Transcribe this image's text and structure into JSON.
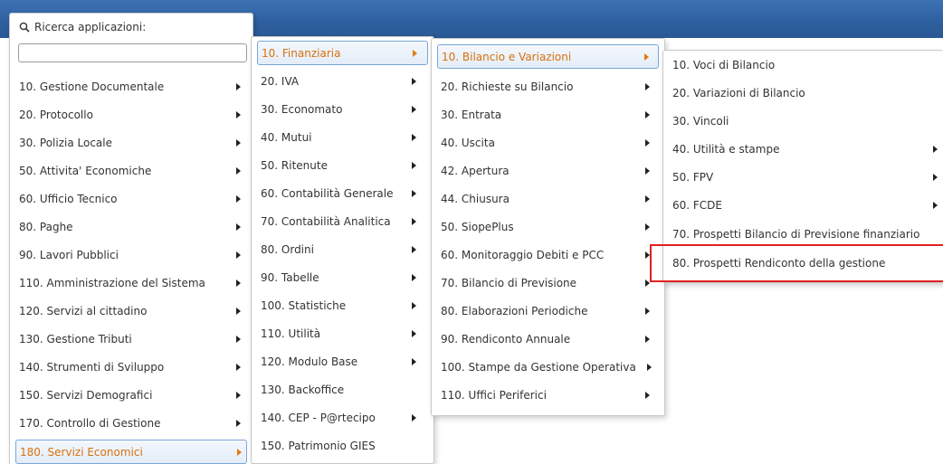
{
  "search": {
    "label": "Ricerca applicazioni:",
    "value": ""
  },
  "menu1": {
    "items": [
      {
        "label": "10. Gestione Documentale"
      },
      {
        "label": "20. Protocollo"
      },
      {
        "label": "30. Polizia Locale"
      },
      {
        "label": "50. Attivita' Economiche"
      },
      {
        "label": "60. Ufficio Tecnico"
      },
      {
        "label": "80. Paghe"
      },
      {
        "label": "90. Lavori Pubblici"
      },
      {
        "label": "110. Amministrazione del Sistema"
      },
      {
        "label": "120. Servizi al cittadino"
      },
      {
        "label": "130. Gestione Tributi"
      },
      {
        "label": "140. Strumenti di Sviluppo"
      },
      {
        "label": "150. Servizi Demografici"
      },
      {
        "label": "170. Controllo di Gestione"
      },
      {
        "label": "180. Servizi Economici"
      }
    ]
  },
  "menu2": {
    "items": [
      {
        "label": "10. Finanziaria"
      },
      {
        "label": "20. IVA"
      },
      {
        "label": "30. Economato"
      },
      {
        "label": "40. Mutui"
      },
      {
        "label": "50. Ritenute"
      },
      {
        "label": "60. Contabilità Generale"
      },
      {
        "label": "70. Contabilità Analitica"
      },
      {
        "label": "80. Ordini"
      },
      {
        "label": "90. Tabelle"
      },
      {
        "label": "100. Statistiche"
      },
      {
        "label": "110. Utilità"
      },
      {
        "label": "120. Modulo Base"
      },
      {
        "label": "130. Backoffice"
      },
      {
        "label": "140. CEP - P@rtecipo"
      },
      {
        "label": "150. Patrimonio GIES"
      }
    ]
  },
  "menu3": {
    "items": [
      {
        "label": "10. Bilancio e Variazioni"
      },
      {
        "label": "20. Richieste su Bilancio"
      },
      {
        "label": "30. Entrata"
      },
      {
        "label": "40. Uscita"
      },
      {
        "label": "42. Apertura"
      },
      {
        "label": "44. Chiusura"
      },
      {
        "label": "50. SiopePlus"
      },
      {
        "label": "60. Monitoraggio Debiti e PCC"
      },
      {
        "label": "70. Bilancio di Previsione"
      },
      {
        "label": "80. Elaborazioni Periodiche"
      },
      {
        "label": "90. Rendiconto Annuale"
      },
      {
        "label": "100. Stampe da Gestione Operativa"
      },
      {
        "label": "110. Uffici Periferici"
      }
    ]
  },
  "menu4": {
    "items": [
      {
        "label": "10. Voci di Bilancio"
      },
      {
        "label": "20. Variazioni di Bilancio"
      },
      {
        "label": "30. Vincoli"
      },
      {
        "label": "40. Utilità e stampe"
      },
      {
        "label": "50. FPV"
      },
      {
        "label": "60. FCDE"
      },
      {
        "label": "70. Prospetti Bilancio di Previsione finanziario"
      },
      {
        "label": "80. Prospetti Rendiconto della gestione"
      }
    ]
  },
  "colors": {
    "accent": "#d9700d",
    "highlight": "#e02020",
    "topbar": "#2d5f9e"
  },
  "icons": {
    "search": "search-icon",
    "submenu": "chevron-right-icon"
  }
}
